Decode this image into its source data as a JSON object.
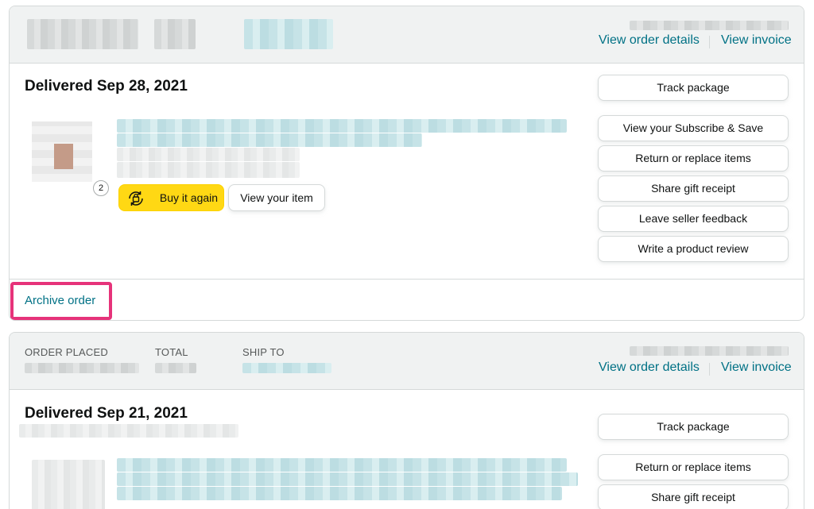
{
  "order1": {
    "view_details": "View order details",
    "view_invoice": "View invoice",
    "delivered": "Delivered Sep 28, 2021",
    "quantity": "2",
    "buy_again": "Buy it again",
    "view_item": "View your item",
    "actions": {
      "track": "Track package",
      "subscribe": "View your Subscribe & Save",
      "return": "Return or replace items",
      "gift": "Share gift receipt",
      "seller_feedback": "Leave seller feedback",
      "review": "Write a product review"
    },
    "archive": "Archive order",
    "highlight_color": "#e6337a"
  },
  "order2": {
    "order_placed_label": "ORDER PLACED",
    "total_label": "TOTAL",
    "ship_to_label": "SHIP TO",
    "view_details": "View order details",
    "view_invoice": "View invoice",
    "delivered": "Delivered Sep 21, 2021",
    "actions": {
      "track": "Track package",
      "return": "Return or replace items",
      "gift": "Share gift receipt"
    }
  },
  "colors": {
    "link": "#007185",
    "buy_button": "#ffd814",
    "header_bg": "#f0f2f2",
    "border": "#d5d9d9"
  }
}
